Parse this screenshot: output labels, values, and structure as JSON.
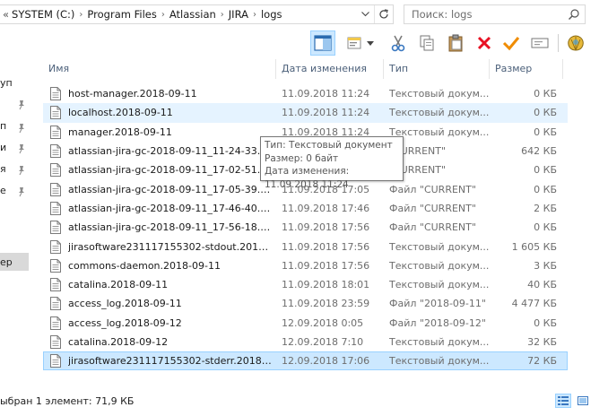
{
  "address_bar": {
    "lead": "«",
    "crumbs": [
      "SYSTEM (C:)",
      "Program Files",
      "Atlassian",
      "JIRA",
      "logs"
    ],
    "separator": "›"
  },
  "search": {
    "placeholder": "Поиск: logs"
  },
  "toolbar": {
    "buttons": [
      "preview-pane",
      "properties",
      "cut",
      "copy",
      "paste",
      "delete",
      "check",
      "rename",
      "extra"
    ]
  },
  "nav": {
    "items": [
      {
        "label": "уп",
        "pinned": true
      },
      {
        "label": "п",
        "pinned": true
      },
      {
        "label": "и",
        "pinned": true
      },
      {
        "label": "я",
        "pinned": true
      },
      {
        "label": "е",
        "pinned": true
      },
      {
        "label": "ер",
        "pinned": false,
        "selected": true
      }
    ]
  },
  "columns": {
    "name": "Имя",
    "date": "Дата изменения",
    "type": "Тип",
    "size": "Размер"
  },
  "files": [
    {
      "name": "host-manager.2018-09-11",
      "date": "11.09.2018 11:24",
      "type": "Текстовый докум...",
      "size": "0 КБ"
    },
    {
      "name": "localhost.2018-09-11",
      "date": "11.09.2018 11:24",
      "type": "Текстовый докум...",
      "size": "0 КБ"
    },
    {
      "name": "manager.2018-09-11",
      "date": "11.09.2018 11:24",
      "type": "Текстовый докум...",
      "size": "0 КБ"
    },
    {
      "name": "atlassian-jira-gc-2018-09-11_11-24-33.lo...",
      "date": "",
      "type": "\"CURRENT\"",
      "size": "642 КБ"
    },
    {
      "name": "atlassian-jira-gc-2018-09-11_17-02-51.lo...",
      "date": "",
      "type": "\"CURRENT\"",
      "size": "0 КБ"
    },
    {
      "name": "atlassian-jira-gc-2018-09-11_17-05-39.lo...",
      "date": "11.09.2018 17:05",
      "type": "Файл \"CURRENT\"",
      "size": "0 КБ"
    },
    {
      "name": "atlassian-jira-gc-2018-09-11_17-46-40.lo...",
      "date": "11.09.2018 17:46",
      "type": "Файл \"CURRENT\"",
      "size": "2 КБ"
    },
    {
      "name": "atlassian-jira-gc-2018-09-11_17-56-18.lo...",
      "date": "11.09.2018 17:56",
      "type": "Файл \"CURRENT\"",
      "size": "0 КБ"
    },
    {
      "name": "jirasoftware231117155302-stdout.2018-09...",
      "date": "11.09.2018 17:56",
      "type": "Текстовый докум...",
      "size": "1 605 КБ"
    },
    {
      "name": "commons-daemon.2018-09-11",
      "date": "11.09.2018 17:56",
      "type": "Текстовый докум...",
      "size": "3 КБ"
    },
    {
      "name": "catalina.2018-09-11",
      "date": "11.09.2018 18:01",
      "type": "Текстовый докум...",
      "size": "40 КБ"
    },
    {
      "name": "access_log.2018-09-11",
      "date": "11.09.2018 23:59",
      "type": "Файл \"2018-09-11\"",
      "size": "4 477 КБ"
    },
    {
      "name": "access_log.2018-09-12",
      "date": "12.09.2018 0:05",
      "type": "Файл \"2018-09-12\"",
      "size": "0 КБ"
    },
    {
      "name": "catalina.2018-09-12",
      "date": "12.09.2018 7:10",
      "type": "Текстовый докум...",
      "size": "32 КБ"
    },
    {
      "name": "jirasoftware231117155302-stderr.2018-09-...",
      "date": "12.09.2018 17:06",
      "type": "Текстовый докум...",
      "size": "72 КБ"
    }
  ],
  "hover_row": 1,
  "selected_row": 14,
  "tooltip": {
    "line1": "Тип: Текстовый документ",
    "line2": "Размер: 0 байт",
    "line3": "Дата изменения: 11.09.2018 11:24"
  },
  "status": {
    "text": "ыбран 1 элемент: 71,9 КБ"
  },
  "colors": {
    "hover": "#e5f3ff",
    "selected": "#cce8ff",
    "selected_border": "#99d1ff",
    "header_text": "#4c607a",
    "delete_red": "#e81123",
    "check_orange": "#f08c00"
  }
}
